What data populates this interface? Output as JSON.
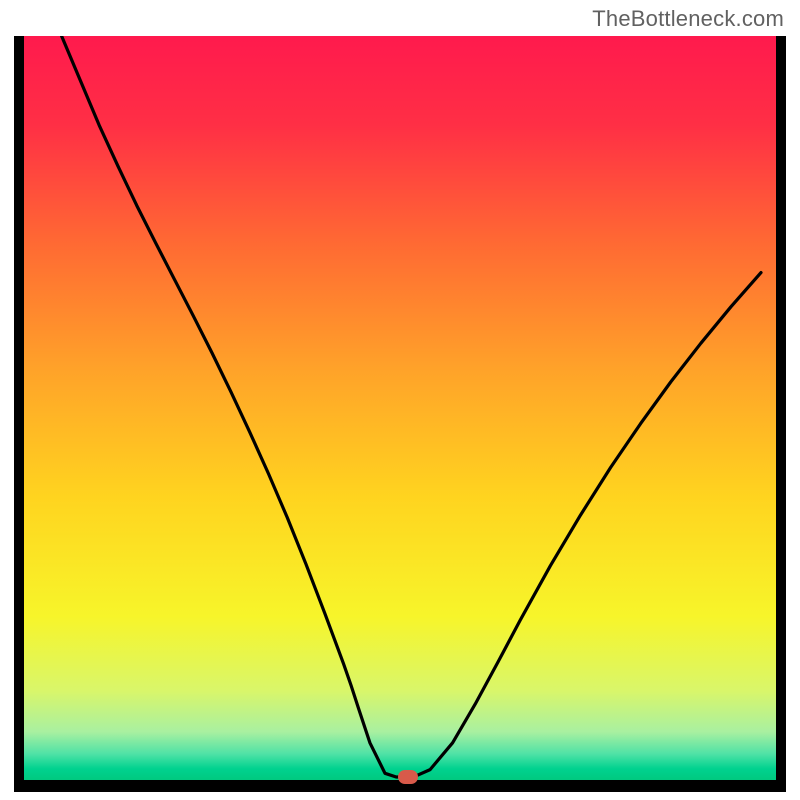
{
  "attribution": "TheBottleneck.com",
  "chart_data": {
    "type": "line",
    "title": "",
    "xlabel": "",
    "ylabel": "",
    "xlim": [
      0,
      100
    ],
    "ylim": [
      0,
      100
    ],
    "grid": false,
    "legend": false,
    "curve_x": [
      5.0,
      7.5,
      10.0,
      12.5,
      15.0,
      17.5,
      20.0,
      22.5,
      25.0,
      27.5,
      30.0,
      32.5,
      35.0,
      37.5,
      40.0,
      42.5,
      43.5,
      44.5,
      46.0,
      48.0,
      49.5,
      51.0,
      52.0,
      54.0,
      57.0,
      60.0,
      63.0,
      66.0,
      70.0,
      74.0,
      78.0,
      82.0,
      86.0,
      90.0,
      94.0,
      98.0
    ],
    "curve_y": [
      100.0,
      94.0,
      88.0,
      82.5,
      77.2,
      72.2,
      67.3,
      62.4,
      57.4,
      52.2,
      46.8,
      41.2,
      35.3,
      29.0,
      22.4,
      15.6,
      12.7,
      9.6,
      5.0,
      0.9,
      0.4,
      0.4,
      0.5,
      1.4,
      5.0,
      10.2,
      15.8,
      21.5,
      28.8,
      35.6,
      42.0,
      47.9,
      53.5,
      58.7,
      63.6,
      68.2
    ],
    "flat_segment": {
      "x0": 48.0,
      "x1": 52.0,
      "y": 0.4
    },
    "marker": {
      "x": 51.1,
      "y": 0.4,
      "color": "#d85a4a"
    },
    "background_gradient": {
      "stops": [
        {
          "pos": 0.0,
          "color": "#ff1a4d"
        },
        {
          "pos": 0.12,
          "color": "#ff2f45"
        },
        {
          "pos": 0.28,
          "color": "#ff6a33"
        },
        {
          "pos": 0.45,
          "color": "#ffa329"
        },
        {
          "pos": 0.62,
          "color": "#ffd41f"
        },
        {
          "pos": 0.78,
          "color": "#f7f52a"
        },
        {
          "pos": 0.88,
          "color": "#d9f66a"
        },
        {
          "pos": 0.935,
          "color": "#a9f0a0"
        },
        {
          "pos": 0.965,
          "color": "#4fe2a6"
        },
        {
          "pos": 0.985,
          "color": "#00d28f"
        },
        {
          "pos": 1.0,
          "color": "#00c97f"
        }
      ]
    }
  }
}
